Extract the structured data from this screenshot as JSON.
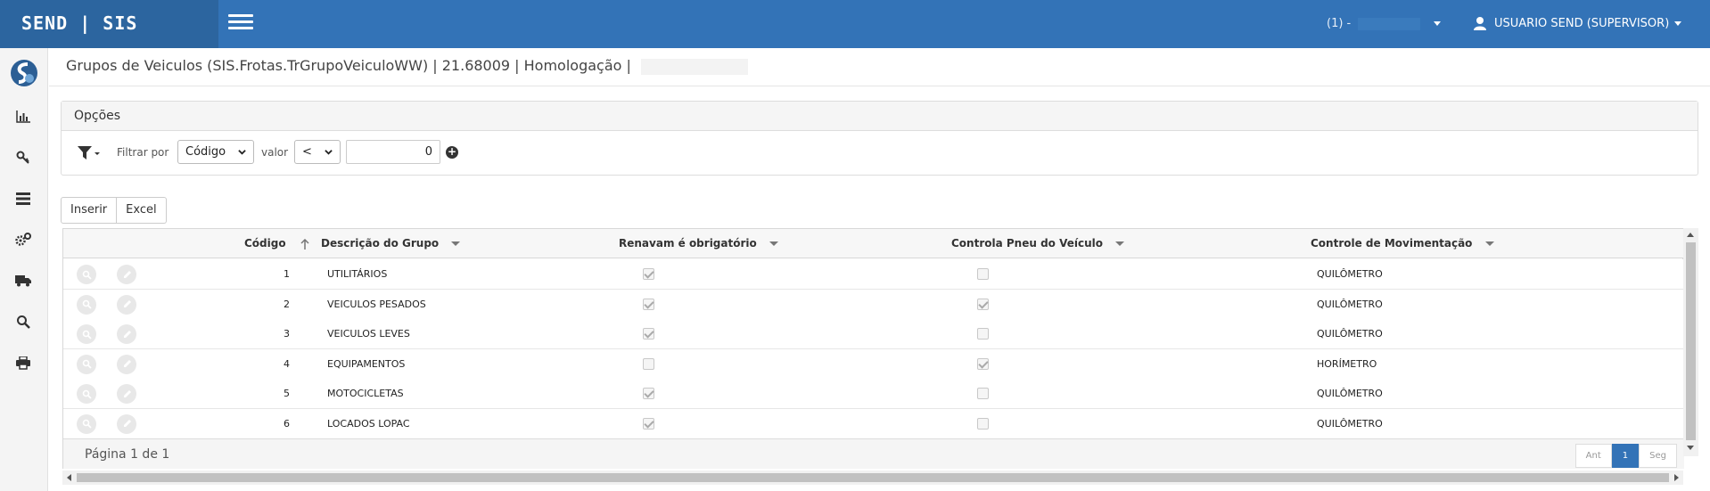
{
  "brand": "SEND | SIS",
  "header": {
    "company_label": "(1) -",
    "user_label": "USUARIO SEND (SUPERVISOR)"
  },
  "page": {
    "title": "Grupos de Veiculos (SIS.Frotas.TrGrupoVeiculoWW) | 21.68009 | Homologação |"
  },
  "options": {
    "title": "Opções",
    "filter_by_label": "Filtrar por",
    "filter_field": "Código",
    "value_label": "valor",
    "operator": "<",
    "value": "0"
  },
  "actions": {
    "insert": "Inserir",
    "excel": "Excel"
  },
  "grid": {
    "columns": {
      "codigo": "Código",
      "descricao": "Descrição do Grupo",
      "renavam": "Renavam é obrigatório",
      "pneu": "Controla Pneu do Veículo",
      "movimentacao": "Controle de Movimentação"
    },
    "rows": [
      {
        "codigo": "1",
        "descricao": "UTILITÁRIOS",
        "renavam": true,
        "pneu": false,
        "movimentacao": "QUILÔMETRO"
      },
      {
        "codigo": "2",
        "descricao": "VEICULOS PESADOS",
        "renavam": true,
        "pneu": true,
        "movimentacao": "QUILÔMETRO"
      },
      {
        "codigo": "3",
        "descricao": "VEICULOS LEVES",
        "renavam": true,
        "pneu": false,
        "movimentacao": "QUILÔMETRO"
      },
      {
        "codigo": "4",
        "descricao": "EQUIPAMENTOS",
        "renavam": false,
        "pneu": true,
        "movimentacao": "HORÍMETRO"
      },
      {
        "codigo": "5",
        "descricao": "MOTOCICLETAS",
        "renavam": true,
        "pneu": false,
        "movimentacao": "QUILÔMETRO"
      },
      {
        "codigo": "6",
        "descricao": "LOCADOS LOPAC",
        "renavam": true,
        "pneu": false,
        "movimentacao": "QUILÔMETRO"
      }
    ],
    "page_info": "Página 1 de 1",
    "pager": {
      "prev": "Ant",
      "current": "1",
      "next": "Seg"
    }
  },
  "icons": {
    "sidebar": [
      "bar-chart-icon",
      "key-icon",
      "list-icon",
      "gears-icon",
      "truck-icon",
      "search-icon",
      "print-icon"
    ],
    "row_actions": [
      "view-icon",
      "edit-icon"
    ]
  },
  "colors": {
    "topbar": "#3373b7",
    "brand_bg": "#2c659f",
    "active_page": "#3373b7"
  }
}
